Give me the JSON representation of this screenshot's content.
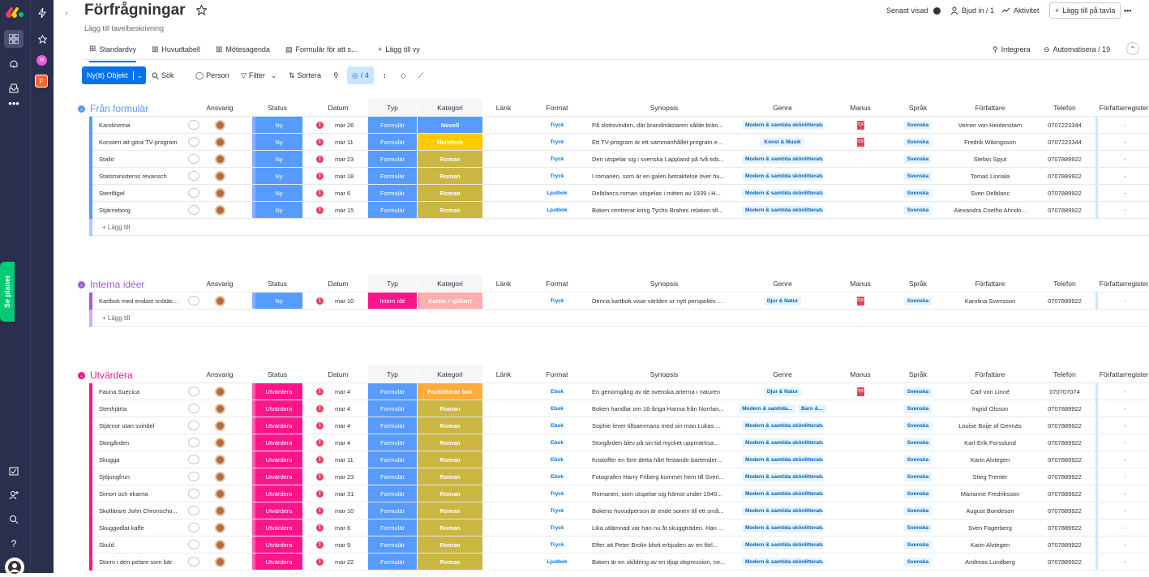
{
  "board": {
    "title": "Förfrågningar",
    "subtitle": "Lägg till tavelbeskrivning"
  },
  "header": {
    "last_seen": "Senast visad",
    "invite": "Bjud in / 1",
    "activity": "Aktivitet",
    "add_board": "Lägg till på tavla",
    "more": "•••"
  },
  "tabs": [
    "Standardvy",
    "Huvudtabell",
    "Mötesagenda",
    "Formulär för att s...",
    "Lägg till vy"
  ],
  "tab_right": {
    "integrate": "Integrera",
    "automate": "Automatisera / 19"
  },
  "toolbar": {
    "new_item": "Ny(tt) Objekt",
    "search": "Sök",
    "person": "Person",
    "filter": "Filter",
    "sort": "Sortera",
    "hidden": "/ 4"
  },
  "sidebar": {
    "se_planer": "Se planer",
    "workspace1": "H",
    "workspace2": "F"
  },
  "columns": [
    "Ansvarig",
    "Status",
    "Datum",
    "Typ",
    "Kategori",
    "Länk",
    "Format",
    "Synopsis",
    "Genre",
    "Manus",
    "Språk",
    "Författare",
    "Telefon",
    "Författarregister"
  ],
  "add_item": "+ Lägg till",
  "colors": {
    "blue": "#579bfc",
    "green_dark": "#00ca72",
    "pink": "#ff158a",
    "purple": "#a25ddc",
    "status_ny": "#579bfc",
    "status_utv": "#ff158a",
    "typ": "#579bfc",
    "intern": "#ff158a",
    "novell": "#579bfc",
    "handbok": "#ffcb00",
    "roman": "#cab641",
    "kartor": "#ffadad",
    "facklitt": "#fdab3d"
  },
  "groups": [
    {
      "title": "Från formulär",
      "color": "#579bfc",
      "rows": [
        {
          "name": "Karolinerna",
          "status": "Ny",
          "date": "mar 26",
          "typ": "Formulär",
          "kat": "Novell",
          "katc": "#579bfc",
          "format": "Tryck",
          "syn": "På slottsvinden, där brandmästaren sålde brän...",
          "genre": [
            "Modern & samtida skönlitteratur"
          ],
          "manus": true,
          "lang": "Svenska",
          "author": "Verner von Heidenstam",
          "phone": "0707223344"
        },
        {
          "name": "Konsten att göra TV-program",
          "status": "Ny",
          "date": "mar 11",
          "typ": "Formulär",
          "kat": "Handbok",
          "katc": "#ffcb00",
          "format": "Tryck",
          "syn": "Ett TV-program är ett sammanhållet program e...",
          "genre": [
            "Konst & Musik"
          ],
          "manus": true,
          "lang": "Svenska",
          "author": "Fredrik Wikingsson",
          "phone": "0707223344"
        },
        {
          "name": "Stallo",
          "status": "Ny",
          "date": "mar 23",
          "typ": "Formulär",
          "kat": "Roman",
          "katc": "#cab641",
          "format": "Tryck",
          "syn": "Den utspelar sig i svenska Lappland på två tids...",
          "genre": [
            "Modern & samtida skönlitteratur"
          ],
          "manus": false,
          "lang": "Svenska",
          "author": "Stefan Spjut",
          "phone": "0707889922"
        },
        {
          "name": "Statsministerns revansch",
          "status": "Ny",
          "date": "mar 18",
          "typ": "Formulär",
          "kat": "Roman",
          "katc": "#cab641",
          "format": "Tryck",
          "syn": "I romanen, som är en galen betraktelse över hu...",
          "genre": [
            "Modern & samtida skönlitteratur"
          ],
          "manus": false,
          "lang": "Svenska",
          "author": "Tomas Linnala",
          "phone": "0707889922"
        },
        {
          "name": "Stenfågel",
          "status": "Ny",
          "date": "mar 6",
          "typ": "Formulär",
          "kat": "Roman",
          "katc": "#cab641",
          "format": "Ljudbok",
          "syn": "Delblancs roman utspelas i mitten av 1939 i H...",
          "genre": [
            "Modern & samtida skönlitteratur"
          ],
          "manus": false,
          "lang": "Svenska",
          "author": "Sven Delblanc",
          "phone": "0707889922"
        },
        {
          "name": "Stjärneborg",
          "status": "Ny",
          "date": "mar 15",
          "typ": "Formulär",
          "kat": "Roman",
          "katc": "#cab641",
          "format": "Ljudbok",
          "syn": "Boken centrerar kring Tycho Brahes relation till...",
          "genre": [
            "Modern & samtida skönlitteratur"
          ],
          "manus": false,
          "lang": "Svenska",
          "author": "Alexandra Coelho Ahndo...",
          "phone": "0707889922"
        }
      ]
    },
    {
      "title": "Interna idéer",
      "color": "#a25ddc",
      "rows": [
        {
          "name": "Kartbok med endast snötäc...",
          "status": "Ny",
          "date": "mar 10",
          "typ": "Intern idé",
          "typc": "#ff158a",
          "kat": "Kartor / sjökort",
          "katc": "#ffadad",
          "format": "Tryck",
          "syn": "Denna kartbok visar världen ur nytt perspektiv ...",
          "genre": [
            "Djur & Natur"
          ],
          "manus": true,
          "lang": "Svenska",
          "author": "Karolina Svensson",
          "phone": "0707889922"
        }
      ]
    },
    {
      "title": "Utvärdera",
      "color": "#ff158a",
      "rows": [
        {
          "name": "Fauna Suecica",
          "status": "Utvärdera",
          "date": "mar 4",
          "typ": "Formulär",
          "kat": "Facklitterär bok",
          "katc": "#fdab3d",
          "format": "Ebok",
          "syn": "En genomgång av de svenska arterna i naturen",
          "genre": [
            "Djur & Natur"
          ],
          "manus": true,
          "lang": "Svenska",
          "author": "Carl von Linné",
          "phone": "070707074"
        },
        {
          "name": "Stenhjärta",
          "status": "Utvärdera",
          "date": "mar 4",
          "typ": "Formulär",
          "kat": "Roman",
          "katc": "#cab641",
          "format": "Ebok",
          "syn": "Boken handlar om 16-åriga Hanna från Norrlan...",
          "genre": [
            "Modern & samtida...",
            "Barn &..."
          ],
          "manus": false,
          "lang": "Svenska",
          "author": "Ingrid Olsson",
          "phone": "0707889922"
        },
        {
          "name": "Stjärnor utan svindel",
          "status": "Utvärdera",
          "date": "mar 4",
          "typ": "Formulär",
          "kat": "Roman",
          "katc": "#cab641",
          "format": "Ebok",
          "syn": "Sophie lever tillsammans med sin man Lukas ...",
          "genre": [
            "Modern & samtida skönlitteratur"
          ],
          "manus": false,
          "lang": "Svenska",
          "author": "Louise Boije af Gennäs",
          "phone": "0707889922"
        },
        {
          "name": "Storgården",
          "status": "Utvärdera",
          "date": "mar 4",
          "typ": "Formulär",
          "kat": "Roman",
          "katc": "#cab641",
          "format": "Ebok",
          "syn": "Storgården blev på sin tid mycket uppmärksa...",
          "genre": [
            "Modern & samtida skönlitteratur"
          ],
          "manus": false,
          "lang": "Svenska",
          "author": "Karl-Erik Forsslund",
          "phone": "0707889922"
        },
        {
          "name": "Skugga",
          "status": "Utvärdera",
          "date": "mar 11",
          "typ": "Formulär",
          "kat": "Roman",
          "katc": "#cab641",
          "format": "Ebok",
          "syn": "Kristoffer en före detta hårt festande bartender...",
          "genre": [
            "Modern & samtida skönlitteratur"
          ],
          "manus": false,
          "lang": "Svenska",
          "author": "Karin Alvtegen",
          "phone": "0707889922"
        },
        {
          "name": "Sjöjungfrun",
          "status": "Utvärdera",
          "date": "mar 23",
          "typ": "Formulär",
          "kat": "Roman",
          "katc": "#cab641",
          "format": "Ebok",
          "syn": "Fotografen Harry Friberg kommer hem till Sveri...",
          "genre": [
            "Modern & samtida skönlitteratur"
          ],
          "manus": false,
          "lang": "Svenska",
          "author": "Stieg Trenter",
          "phone": "0707889922"
        },
        {
          "name": "Simon och ekarna",
          "status": "Utvärdera",
          "date": "mar 31",
          "typ": "Formulär",
          "kat": "Roman",
          "katc": "#cab641",
          "format": "Tryck",
          "syn": "Romanen, som utspelar sig främst under 1940...",
          "genre": [
            "Modern & samtida skönlitteratur"
          ],
          "manus": false,
          "lang": "Svenska",
          "author": "Marianne Fredriksson",
          "phone": "0707889922"
        },
        {
          "name": "Skollärare John Chronscho...",
          "status": "Utvärdera",
          "date": "mar 10",
          "typ": "Formulär",
          "kat": "Roman",
          "katc": "#cab641",
          "format": "Tryck",
          "syn": "Bokens huvudperson är ende sonen till ett små...",
          "genre": [
            "Modern & samtida skönlitteratur"
          ],
          "manus": false,
          "lang": "Svenska",
          "author": "August Bondeson",
          "phone": "0707889922"
        },
        {
          "name": "Skuggodlat kaffe",
          "status": "Utvärdera",
          "date": "mar 6",
          "typ": "Formulär",
          "kat": "Roman",
          "katc": "#cab641",
          "format": "Tryck",
          "syn": "Lika utlämnad var han nu åt skuggträden. Han ...",
          "genre": [
            "Modern & samtida skönlitteratur"
          ],
          "manus": false,
          "lang": "Svenska",
          "author": "Sven Fagerberg",
          "phone": "0707889922"
        },
        {
          "name": "Skuld",
          "status": "Utvärdera",
          "date": "mar 9",
          "typ": "Formulär",
          "kat": "Roman",
          "katc": "#cab641",
          "format": "Tryck",
          "syn": "Efter att Peter Brolin blivit erbjuden av en förl...",
          "genre": [
            "Modern & samtida skönlitteratur"
          ],
          "manus": false,
          "lang": "Svenska",
          "author": "Karin Alvtegen",
          "phone": "0707889922"
        },
        {
          "name": "Storm i den pelare som bär",
          "status": "Utvärdera",
          "date": "mar 22",
          "typ": "Formulär",
          "kat": "Roman",
          "katc": "#cab641",
          "format": "Ljudbok",
          "syn": "Boken är en skildring av en djup depression, ne...",
          "genre": [
            "Modern & samtida skönlitteratur"
          ],
          "manus": false,
          "lang": "Svenska",
          "author": "Andreas Lundberg",
          "phone": "0707889922"
        }
      ]
    }
  ]
}
